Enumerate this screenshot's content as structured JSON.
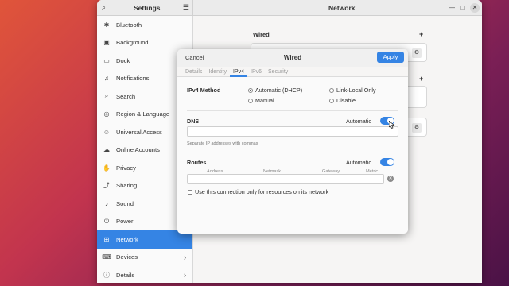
{
  "settings": {
    "app_title": "Settings",
    "page_title": "Network",
    "sidebar": [
      {
        "label": "Bluetooth",
        "icon": "bluetooth-icon",
        "glyph": "✱",
        "active": false,
        "chevron": false
      },
      {
        "label": "Background",
        "icon": "background-icon",
        "glyph": "▣",
        "active": false,
        "chevron": false
      },
      {
        "label": "Dock",
        "icon": "dock-icon",
        "glyph": "▭",
        "active": false,
        "chevron": false
      },
      {
        "label": "Notifications",
        "icon": "bell-icon",
        "glyph": "♫",
        "active": false,
        "chevron": false
      },
      {
        "label": "Search",
        "icon": "search-icon",
        "glyph": "⌕",
        "active": false,
        "chevron": false
      },
      {
        "label": "Region & Language",
        "icon": "globe-icon",
        "glyph": "◎",
        "active": false,
        "chevron": false
      },
      {
        "label": "Universal Access",
        "icon": "accessibility-icon",
        "glyph": "☺",
        "active": false,
        "chevron": false
      },
      {
        "label": "Online Accounts",
        "icon": "cloud-icon",
        "glyph": "☁",
        "active": false,
        "chevron": false
      },
      {
        "label": "Privacy",
        "icon": "hand-icon",
        "glyph": "✋",
        "active": false,
        "chevron": false
      },
      {
        "label": "Sharing",
        "icon": "share-icon",
        "glyph": "⤴",
        "active": false,
        "chevron": false
      },
      {
        "label": "Sound",
        "icon": "speaker-icon",
        "glyph": "♪",
        "active": false,
        "chevron": false
      },
      {
        "label": "Power",
        "icon": "power-icon",
        "glyph": "⏻",
        "active": false,
        "chevron": false
      },
      {
        "label": "Network",
        "icon": "network-icon",
        "glyph": "⊞",
        "active": true,
        "chevron": false
      },
      {
        "label": "Devices",
        "icon": "devices-icon",
        "glyph": "⌨",
        "active": false,
        "chevron": true
      },
      {
        "label": "Details",
        "icon": "info-icon",
        "glyph": "ⓘ",
        "active": false,
        "chevron": true
      }
    ],
    "network": {
      "wired_heading": "Wired"
    }
  },
  "dialog": {
    "cancel_label": "Cancel",
    "title": "Wired",
    "apply_label": "Apply",
    "tabs": [
      {
        "label": "Details",
        "active": false
      },
      {
        "label": "Identity",
        "active": false
      },
      {
        "label": "IPv4",
        "active": true
      },
      {
        "label": "IPv6",
        "active": false
      },
      {
        "label": "Security",
        "active": false
      }
    ],
    "ipv4_method_label": "IPv4 Method",
    "methods": {
      "automatic_dhcp": "Automatic (DHCP)",
      "link_local": "Link-Local Only",
      "manual": "Manual",
      "disable": "Disable"
    },
    "selected_method": "Automatic (DHCP)",
    "dns": {
      "label": "DNS",
      "automatic_label": "Automatic",
      "automatic_on": true,
      "value": "",
      "hint": "Separate IP addresses with commas"
    },
    "routes": {
      "label": "Routes",
      "automatic_label": "Automatic",
      "automatic_on": true,
      "columns": [
        "Address",
        "Netmask",
        "Gateway",
        "Metric"
      ]
    },
    "restrict_checkbox_label": "Use this connection only for resources on its network",
    "restrict_checked": false
  }
}
